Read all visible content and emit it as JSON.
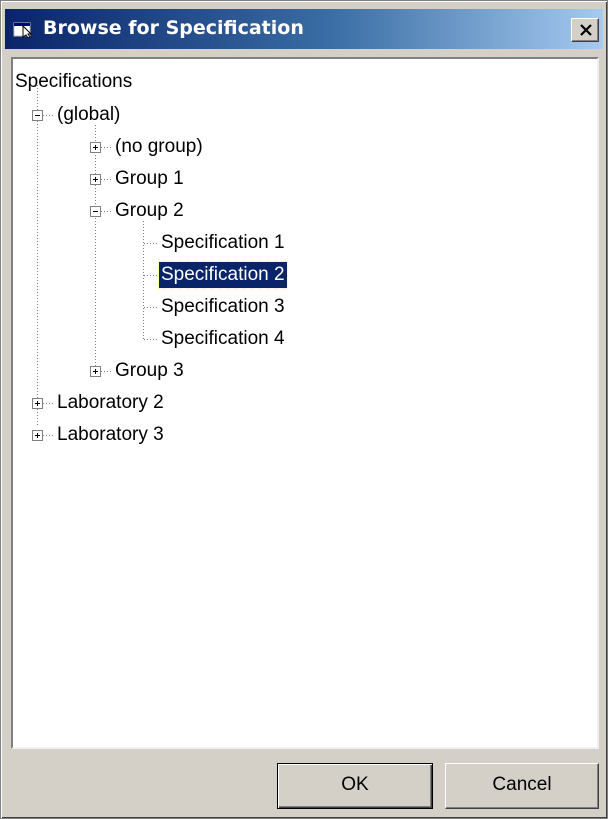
{
  "window": {
    "title": "Browse for Specification",
    "icon": "browse-window-icon",
    "close_icon": "close-icon"
  },
  "tree": {
    "root": "Specifications",
    "nodes": [
      {
        "label": "(global)",
        "expanded": true
      },
      {
        "label": "(no group)",
        "expanded": false
      },
      {
        "label": "Group 1",
        "expanded": false
      },
      {
        "label": "Group 2",
        "expanded": true
      },
      {
        "label": "Specification 1"
      },
      {
        "label": "Specification 2",
        "selected": true
      },
      {
        "label": "Specification 3"
      },
      {
        "label": "Specification 4"
      },
      {
        "label": "Group 3",
        "expanded": false
      },
      {
        "label": "Laboratory 2",
        "expanded": false
      },
      {
        "label": "Laboratory 3",
        "expanded": false
      }
    ]
  },
  "buttons": {
    "ok": "OK",
    "cancel": "Cancel"
  },
  "colors": {
    "selection": "#0a246a",
    "titlebar": "#0a246a",
    "face": "#d4d0c8"
  }
}
